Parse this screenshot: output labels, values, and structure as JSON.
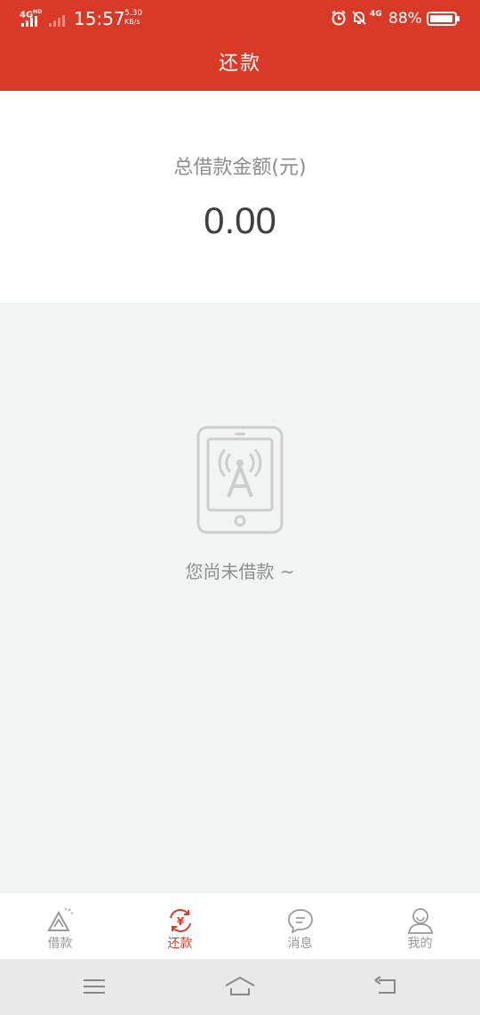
{
  "status_bar": {
    "network": "4G",
    "network_sup": "HD",
    "time": "15:57",
    "speed_value": "5.30",
    "speed_unit": "KB/s",
    "network2": "4G",
    "battery": "88%"
  },
  "header": {
    "title": "还款"
  },
  "summary": {
    "label": "总借款金额(元)",
    "amount": "0.00"
  },
  "empty_state": {
    "message": "您尚未借款 ~"
  },
  "tabs": [
    {
      "label": "借款",
      "icon": "loan-icon",
      "active": false
    },
    {
      "label": "还款",
      "icon": "repay-icon",
      "active": true
    },
    {
      "label": "消息",
      "icon": "message-icon",
      "active": false
    },
    {
      "label": "我的",
      "icon": "profile-icon",
      "active": false
    }
  ],
  "colors": {
    "brand": "#d93a28",
    "background": "#f2f3f3",
    "inactive": "#999999"
  }
}
